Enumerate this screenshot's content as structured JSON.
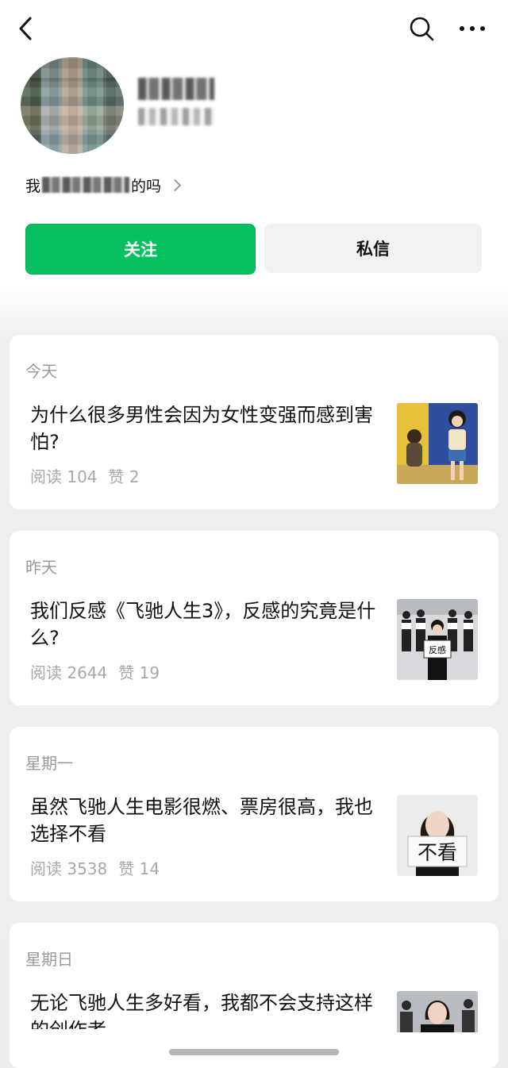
{
  "nav": {
    "back_icon": "chevron-left-icon",
    "search_icon": "search-icon",
    "more_icon": "more-horizontal-icon"
  },
  "profile": {
    "bio_prefix": "我",
    "bio_suffix": "的吗"
  },
  "actions": {
    "follow_label": "关注",
    "message_label": "私信",
    "follow_color": "#07c160"
  },
  "articles": [
    {
      "date": "今天",
      "title": "为什么很多男性会因为女性变强而感到害怕?",
      "reads": "阅读 104",
      "likes": "赞 2"
    },
    {
      "date": "昨天",
      "title": "我们反感《飞驰人生3》，反感的究竟是什么?",
      "reads": "阅读 2644",
      "likes": "赞 19",
      "thumb_sign": "反感"
    },
    {
      "date": "星期一",
      "title": "虽然飞驰人生电影很燃、票房很高，我也选择不看",
      "reads": "阅读 3538",
      "likes": "赞 14",
      "thumb_sign": "不看"
    },
    {
      "date": "星期日",
      "title": "无论飞驰人生多好看，我都不会支持这样的创作者"
    }
  ]
}
